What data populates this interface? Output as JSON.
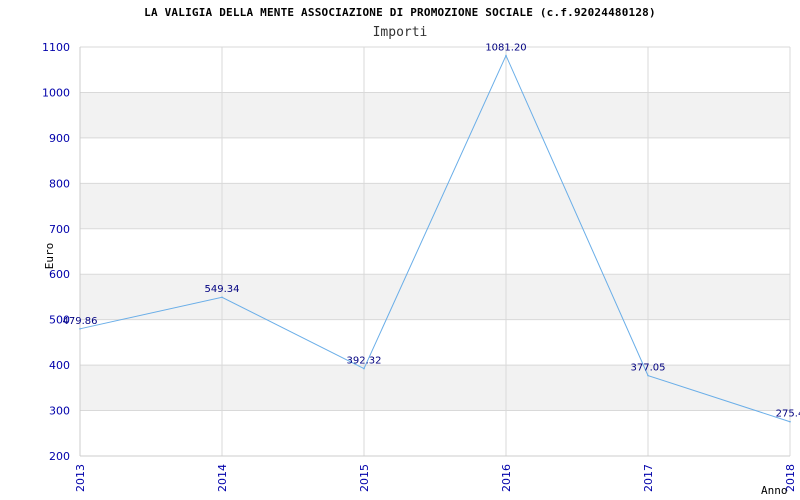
{
  "header": {
    "title": "LA VALIGIA DELLA MENTE ASSOCIAZIONE DI PROMOZIONE SOCIALE (c.f.92024480128)",
    "subtitle": "Importi"
  },
  "colors": {
    "line": "#6aaee8",
    "band": "#f2f2f2",
    "grid": "#d9d9d9",
    "tick_text": "#0000aa",
    "data_label": "#000080"
  },
  "chart_data": {
    "type": "line",
    "title": "Importi",
    "xlabel": "Anno",
    "ylabel": "Euro",
    "x": [
      "2013",
      "2014",
      "2015",
      "2016",
      "2017",
      "2018"
    ],
    "values": [
      479.86,
      549.34,
      392.32,
      1081.2,
      377.05,
      275.4
    ],
    "value_labels": [
      "479.86",
      "549.34",
      "392.32",
      "1081.20",
      "377.05",
      "275.4"
    ],
    "ylim": [
      200,
      1100
    ],
    "yticks": [
      200,
      300,
      400,
      500,
      600,
      700,
      800,
      900,
      1000,
      1100
    ],
    "grid": true,
    "alternating_bands": true,
    "legend": false
  }
}
